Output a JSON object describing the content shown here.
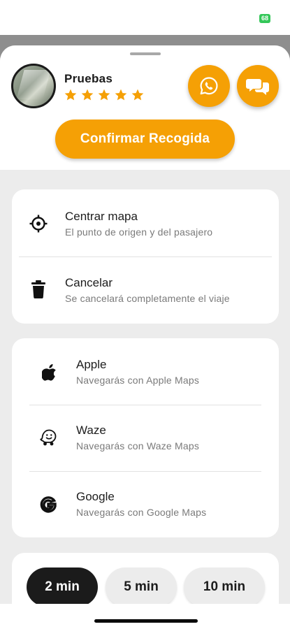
{
  "status_bar": {
    "battery_text": "68"
  },
  "driver": {
    "name": "Pruebas",
    "rating": 5,
    "rating_max": 5
  },
  "actions": {
    "whatsapp_icon": "whatsapp-icon",
    "chat_icon": "chat-bubbles-icon",
    "confirm_label": "Confirmar Recogida"
  },
  "options": [
    {
      "icon": "crosshair-icon",
      "title": "Centrar mapa",
      "subtitle": "El punto de origen y del pasajero"
    },
    {
      "icon": "trash-icon",
      "title": "Cancelar",
      "subtitle": "Se cancelará completamente el viaje"
    }
  ],
  "navigation": [
    {
      "icon": "apple-icon",
      "title": "Apple",
      "subtitle": "Navegarás con Apple Maps"
    },
    {
      "icon": "waze-icon",
      "title": "Waze",
      "subtitle": "Navegarás con Waze Maps"
    },
    {
      "icon": "google-icon",
      "title": "Google",
      "subtitle": "Navegarás con Google Maps"
    }
  ],
  "time_options": [
    {
      "label": "2 min",
      "selected": true
    },
    {
      "label": "5 min",
      "selected": false
    },
    {
      "label": "10 min",
      "selected": false
    }
  ],
  "colors": {
    "accent": "#f5a005",
    "selected_chip": "#1b1b1b",
    "sheet_background": "#ececec"
  }
}
